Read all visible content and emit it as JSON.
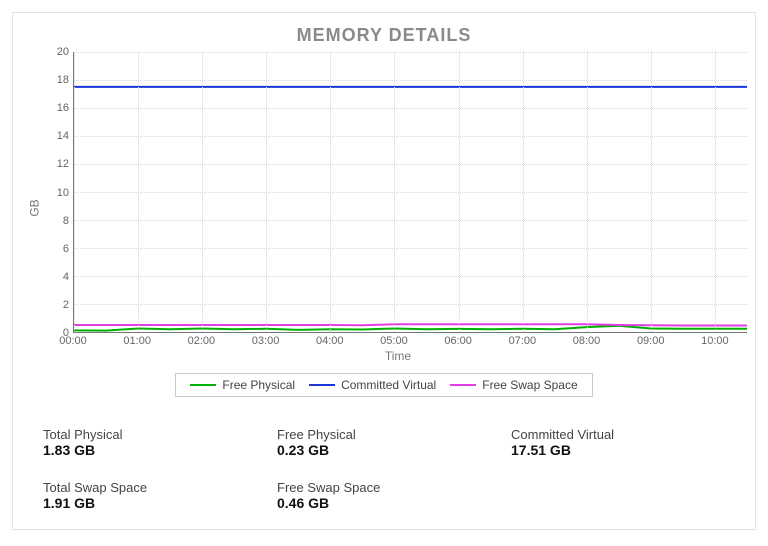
{
  "title": "MEMORY DETAILS",
  "xlabel": "Time",
  "ylabel": "GB",
  "x_ticks": [
    "00:00",
    "01:00",
    "02:00",
    "03:00",
    "04:00",
    "05:00",
    "06:00",
    "07:00",
    "08:00",
    "09:00",
    "10:00"
  ],
  "y_labels": [
    "0",
    "2",
    "4",
    "6",
    "8",
    "10",
    "12",
    "14",
    "16",
    "18",
    "20"
  ],
  "legend": [
    {
      "key": "free_physical",
      "label": "Free Physical",
      "color": "#00b200"
    },
    {
      "key": "committed_virtual",
      "label": "Committed Virtual",
      "color": "#1936d9"
    },
    {
      "key": "free_swap",
      "label": "Free Swap Space",
      "color": "#e23ee2"
    }
  ],
  "stats": [
    {
      "label": "Total Physical",
      "value": "1.83 GB"
    },
    {
      "label": "Free Physical",
      "value": "0.23 GB"
    },
    {
      "label": "Committed Virtual",
      "value": "17.51 GB"
    },
    {
      "label": "Total Swap Space",
      "value": "1.91 GB"
    },
    {
      "label": "Free Swap Space",
      "value": "0.46 GB"
    }
  ],
  "chart_data": {
    "type": "line",
    "title": "MEMORY DETAILS",
    "xlabel": "Time",
    "ylabel": "GB",
    "ylim": [
      0,
      20
    ],
    "x": [
      0,
      0.5,
      1,
      1.5,
      2,
      2.5,
      3,
      3.5,
      4,
      4.5,
      5,
      5.5,
      6,
      6.5,
      7,
      7.5,
      8,
      8.5,
      9,
      9.5,
      10,
      10.5
    ],
    "x_tick_labels": [
      "00:00",
      "01:00",
      "02:00",
      "03:00",
      "04:00",
      "05:00",
      "06:00",
      "07:00",
      "08:00",
      "09:00",
      "10:00"
    ],
    "series": [
      {
        "name": "Free Physical",
        "color": "#00b200",
        "values": [
          0.12,
          0.1,
          0.25,
          0.2,
          0.25,
          0.2,
          0.23,
          0.15,
          0.2,
          0.18,
          0.25,
          0.2,
          0.22,
          0.2,
          0.23,
          0.2,
          0.35,
          0.45,
          0.25,
          0.23,
          0.23,
          0.23
        ]
      },
      {
        "name": "Committed Virtual",
        "color": "#1936d9",
        "values": [
          17.51,
          17.51,
          17.51,
          17.51,
          17.51,
          17.51,
          17.51,
          17.51,
          17.51,
          17.51,
          17.51,
          17.51,
          17.51,
          17.51,
          17.51,
          17.51,
          17.51,
          17.51,
          17.51,
          17.51,
          17.51,
          17.51
        ]
      },
      {
        "name": "Free Swap Space",
        "color": "#e23ee2",
        "values": [
          0.5,
          0.5,
          0.5,
          0.5,
          0.5,
          0.5,
          0.5,
          0.5,
          0.5,
          0.48,
          0.55,
          0.55,
          0.55,
          0.55,
          0.55,
          0.55,
          0.55,
          0.5,
          0.48,
          0.46,
          0.46,
          0.46
        ]
      }
    ],
    "legend_position": "bottom",
    "grid": true
  }
}
